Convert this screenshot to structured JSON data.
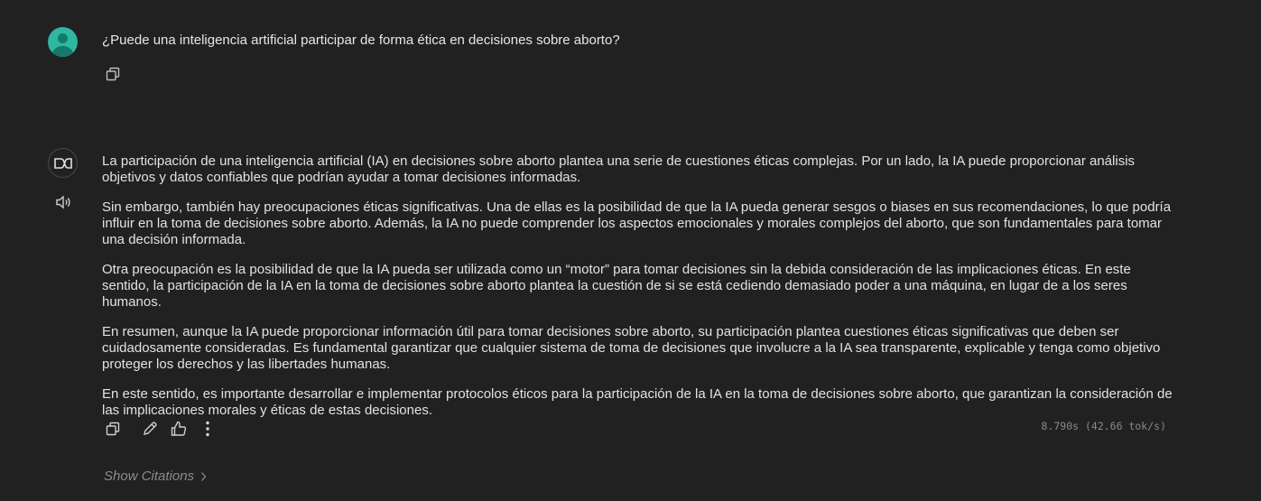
{
  "user_message": {
    "text": "¿Puede una inteligencia artificial participar de forma ética en decisiones sobre aborto?",
    "avatar_color": "#2fb7a0"
  },
  "assistant_message": {
    "paragraphs": [
      "La participación de una inteligencia artificial (IA) en decisiones sobre aborto plantea una serie de cuestiones éticas complejas. Por un lado, la IA puede proporcionar análisis objetivos y datos confiables que podrían ayudar a tomar decisiones informadas.",
      "Sin embargo, también hay preocupaciones éticas significativas. Una de ellas es la posibilidad de que la IA pueda generar sesgos o biases en sus recomendaciones, lo que podría influir en la toma de decisiones sobre aborto. Además, la IA no puede comprender los aspectos emocionales y morales complejos del aborto, que son fundamentales para tomar una decisión informada.",
      "Otra preocupación es la posibilidad de que la IA pueda ser utilizada como un “motor” para tomar decisiones sin la debida consideración de las implicaciones éticas. En este sentido, la participación de la IA en la toma de decisiones sobre aborto plantea la cuestión de si se está cediendo demasiado poder a una máquina, en lugar de a los seres humanos.",
      "En resumen, aunque la IA puede proporcionar información útil para tomar decisiones sobre aborto, su participación plantea cuestiones éticas significativas que deben ser cuidadosamente consideradas. Es fundamental garantizar que cualquier sistema de toma de decisiones que involucre a la IA sea transparente, explicable y tenga como objetivo proteger los derechos y las libertades humanas.",
      "En este sentido, es importante desarrollar e implementar protocolos éticos para la participación de la IA en la toma de decisiones sobre aborto, que garantizan la consideración de las implicaciones morales y éticas de estas decisiones."
    ],
    "timing": "8.790s (42.66 tok/s)",
    "citations_label": "Show Citations"
  },
  "icons": {
    "user_copy": "copy-icon",
    "bot_logo": "model-logo-icon",
    "speaker": "speaker-icon",
    "copy": "copy-icon",
    "edit": "pencil-icon",
    "like": "thumbs-up-icon",
    "more": "more-vertical-icon",
    "chevron": "chevron-right-icon"
  },
  "colors": {
    "background": "#212121",
    "text": "#e2e2e2",
    "muted": "#8c8c8c"
  }
}
